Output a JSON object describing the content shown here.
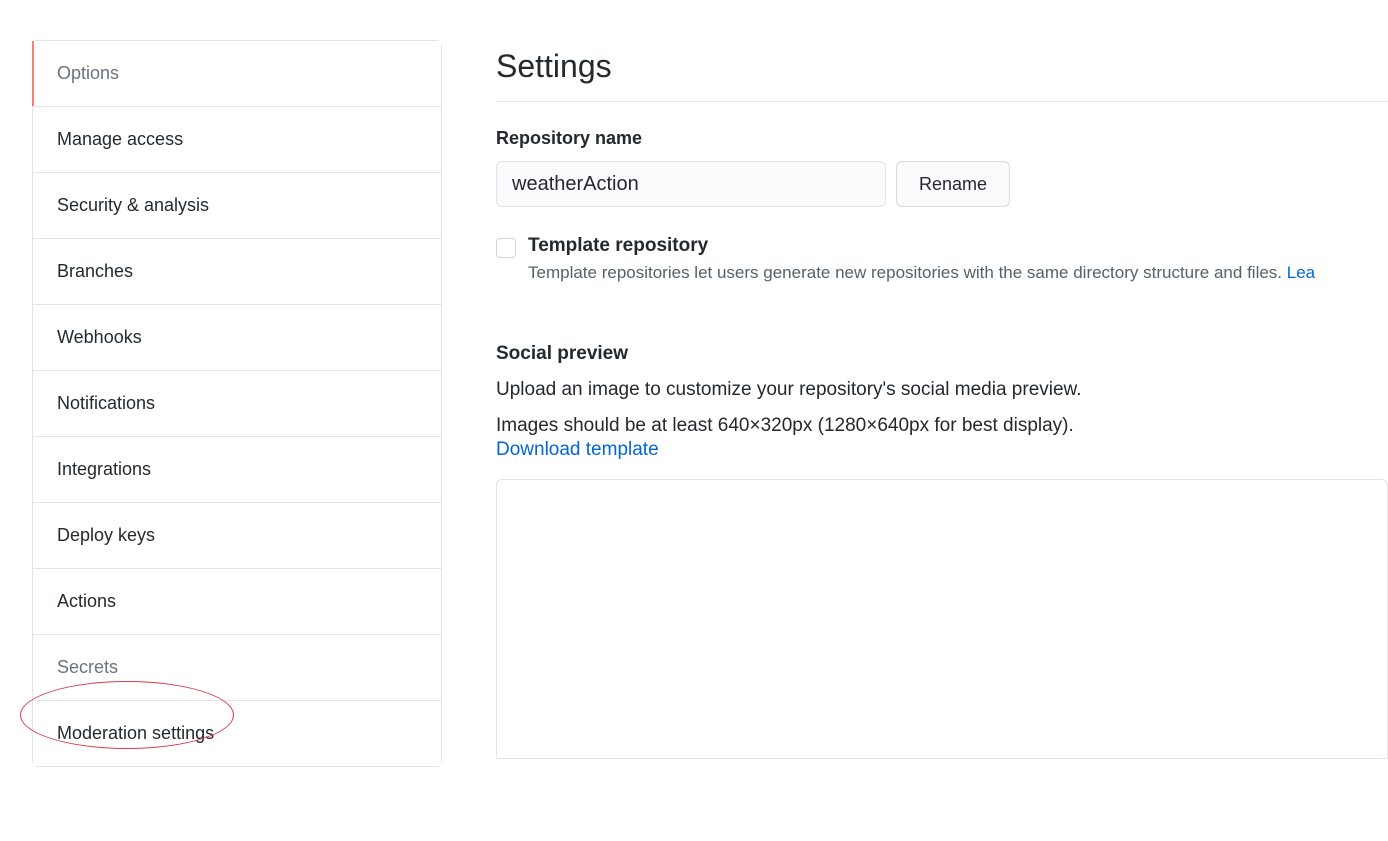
{
  "sidebar": {
    "items": [
      {
        "label": "Options",
        "active": true
      },
      {
        "label": "Manage access"
      },
      {
        "label": "Security & analysis"
      },
      {
        "label": "Branches"
      },
      {
        "label": "Webhooks"
      },
      {
        "label": "Notifications"
      },
      {
        "label": "Integrations"
      },
      {
        "label": "Deploy keys"
      },
      {
        "label": "Actions"
      },
      {
        "label": "Secrets",
        "faded": true,
        "annotated": true
      },
      {
        "label": "Moderation settings"
      }
    ]
  },
  "main": {
    "title": "Settings",
    "repo_name": {
      "label": "Repository name",
      "value": "weatherAction",
      "button": "Rename"
    },
    "template_repo": {
      "title": "Template repository",
      "description": "Template repositories let users generate new repositories with the same directory structure and files. ",
      "link_fragment": "Lea"
    },
    "social_preview": {
      "title": "Social preview",
      "line1": "Upload an image to customize your repository's social media preview.",
      "line2": "Images should be at least 640×320px (1280×640px for best display).",
      "download_link": "Download template"
    }
  }
}
